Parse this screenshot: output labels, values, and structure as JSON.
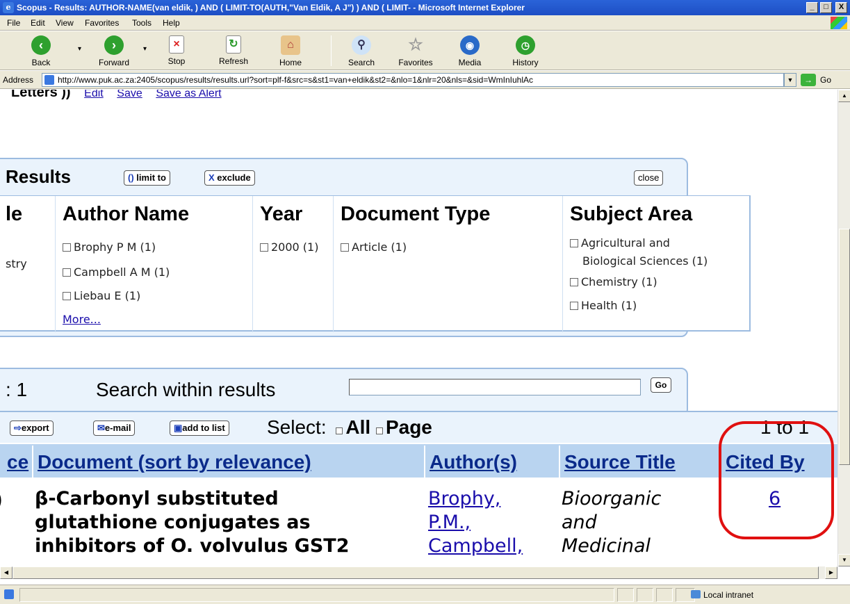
{
  "window": {
    "title": "Scopus - Results: AUTHOR-NAME(van eldik, ) AND ( LIMIT-TO(AUTH,\"Van Eldik, A J\") ) AND ( LIMIT- - Microsoft Internet Explorer",
    "min": "_",
    "max": "□",
    "close": "X"
  },
  "menu": [
    "File",
    "Edit",
    "View",
    "Favorites",
    "Tools",
    "Help"
  ],
  "toolbar": {
    "back": "Back",
    "forward": "Forward",
    "stop": "Stop",
    "refresh": "Refresh",
    "home": "Home",
    "search": "Search",
    "favorites": "Favorites",
    "media": "Media",
    "history": "History"
  },
  "address": {
    "label": "Address",
    "url": "http://www.puk.ac.za:2405/scopus/results/results.url?sort=plf-f&src=s&st1=van+eldik&st2=&nlo=1&nlr=20&nls=&sid=WmInIuhlAc",
    "go": "Go"
  },
  "top_links": {
    "partial": "Letters ))",
    "edit": "Edit",
    "save": "Save",
    "save_alert": "Save as Alert"
  },
  "refine": {
    "header": "Results",
    "limit_to": "limit to",
    "exclude": "exclude",
    "close": "close",
    "columns": [
      {
        "title": "le",
        "options": [
          "stry"
        ]
      },
      {
        "title": "Author Name",
        "options": [
          "Brophy P M (1)",
          "Campbell A M (1)",
          "Liebau E (1)"
        ],
        "more": "More..."
      },
      {
        "title": "Year",
        "options": [
          "2000 (1)"
        ]
      },
      {
        "title": "Document Type",
        "options": [
          "Article (1)"
        ]
      },
      {
        "title": "Subject Area",
        "options": [
          "Agricultural and",
          "Biological Sciences (1)",
          "Chemistry (1)",
          "Health (1)"
        ]
      }
    ]
  },
  "within": {
    "count": ": 1",
    "label": "Search within results",
    "value": "",
    "go": "Go"
  },
  "actions": {
    "export": "export",
    "email": "e-mail",
    "add_to_list": "add to list",
    "select": "Select:",
    "all": "All",
    "page": "Page",
    "range": "1 to 1"
  },
  "table": {
    "headers": [
      "ce",
      "Document (sort by relevance)",
      "Author(s)",
      "Source Title",
      "Cited By"
    ],
    "row": {
      "num": ")",
      "doc_lines": [
        "β-Carbonyl substituted",
        "glutathione conjugates as",
        "inhibitors of O. volvulus GST2"
      ],
      "author_lines": [
        "Brophy,",
        "P.M.,",
        "Campbell,"
      ],
      "source_lines": [
        "Bioorganic",
        "and",
        "Medicinal"
      ],
      "cited_by": "6"
    }
  },
  "status": {
    "zone": "Local intranet"
  },
  "colors": {
    "titlebar": "#2a63d8",
    "panel_border": "#9cbbe0",
    "panel_bg": "#eaf3fc",
    "header_bg": "#b9d4f0",
    "link": "#1a0dab",
    "highlight_circle": "#e01010"
  }
}
